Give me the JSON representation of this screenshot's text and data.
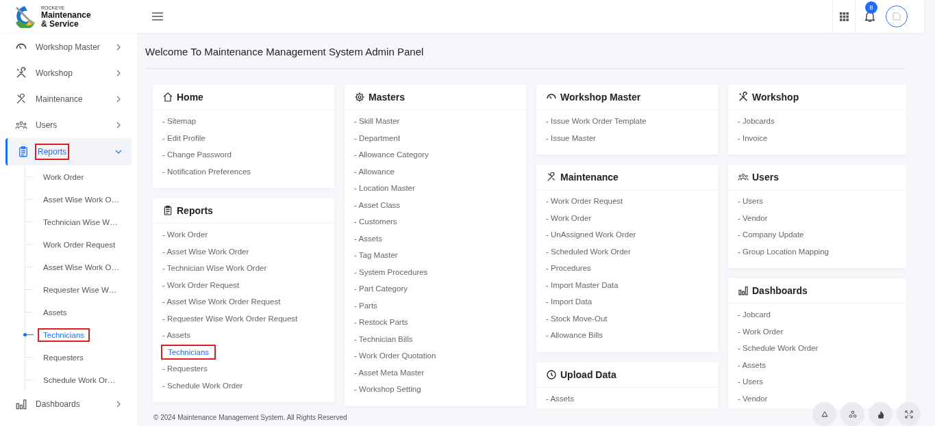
{
  "brand": {
    "small": "ROCKEYE",
    "name": "Maintenance",
    "name_2": "& Service"
  },
  "header": {
    "notification_count": "8"
  },
  "sidebar": {
    "items": [
      {
        "label": "Workshop Master",
        "kind": "gauge",
        "expanded": false,
        "selected": false,
        "highlighted": false
      },
      {
        "label": "Workshop",
        "kind": "tools",
        "expanded": false,
        "selected": false,
        "highlighted": false
      },
      {
        "label": "Maintenance",
        "kind": "wrench",
        "expanded": false,
        "selected": false,
        "highlighted": false
      },
      {
        "label": "Users",
        "kind": "users",
        "expanded": false,
        "selected": false,
        "highlighted": false
      },
      {
        "label": "Reports",
        "kind": "clipboard",
        "expanded": true,
        "selected": true,
        "highlighted": true,
        "children": [
          {
            "label": "Work Order",
            "selected": false,
            "highlighted": false
          },
          {
            "label": "Asset Wise Work O…",
            "selected": false,
            "highlighted": false
          },
          {
            "label": "Technician Wise W…",
            "selected": false,
            "highlighted": false
          },
          {
            "label": "Work Order Request",
            "selected": false,
            "highlighted": false
          },
          {
            "label": "Asset Wise Work O…",
            "selected": false,
            "highlighted": false
          },
          {
            "label": "Requester Wise W…",
            "selected": false,
            "highlighted": false
          },
          {
            "label": "Assets",
            "selected": false,
            "highlighted": false
          },
          {
            "label": "Technicians",
            "selected": true,
            "highlighted": true
          },
          {
            "label": "Requesters",
            "selected": false,
            "highlighted": false
          },
          {
            "label": "Schedule Work Or…",
            "selected": false,
            "highlighted": false
          }
        ]
      },
      {
        "label": "Dashboards",
        "kind": "chart",
        "expanded": false,
        "selected": false,
        "highlighted": false
      }
    ]
  },
  "page_title": "Welcome To Maintenance Management System Admin Panel",
  "columns": [
    [
      {
        "title": "Home",
        "kind": "home",
        "links": [
          {
            "label": "- Sitemap",
            "highlighted": false
          },
          {
            "label": "- Edit Profile",
            "highlighted": false
          },
          {
            "label": "- Change Password",
            "highlighted": false
          },
          {
            "label": "- Notification Preferences",
            "highlighted": false
          }
        ]
      },
      {
        "title": "Reports",
        "kind": "clipboard",
        "links": [
          {
            "label": "- Work Order",
            "highlighted": false
          },
          {
            "label": "- Asset Wise Work Order",
            "highlighted": false
          },
          {
            "label": "- Technician Wise Work Order",
            "highlighted": false
          },
          {
            "label": "- Work Order Request",
            "highlighted": false
          },
          {
            "label": "- Asset Wise Work Order Request",
            "highlighted": false
          },
          {
            "label": "- Requester Wise Work Order Request",
            "highlighted": false
          },
          {
            "label": "- Assets",
            "highlighted": false
          },
          {
            "label": "Technicians",
            "highlighted": true
          },
          {
            "label": "- Requesters",
            "highlighted": false
          },
          {
            "label": "- Schedule Work Order",
            "highlighted": false
          }
        ]
      }
    ],
    [
      {
        "title": "Masters",
        "kind": "gear",
        "links": [
          {
            "label": "- Skill Master",
            "highlighted": false
          },
          {
            "label": "- Department",
            "highlighted": false
          },
          {
            "label": "- Allowance Category",
            "highlighted": false
          },
          {
            "label": "- Allowance",
            "highlighted": false
          },
          {
            "label": "- Location Master",
            "highlighted": false
          },
          {
            "label": "- Asset Class",
            "highlighted": false
          },
          {
            "label": "- Customers",
            "highlighted": false
          },
          {
            "label": "- Assets",
            "highlighted": false
          },
          {
            "label": "- Tag Master",
            "highlighted": false
          },
          {
            "label": "- System Procedures",
            "highlighted": false
          },
          {
            "label": "- Part Category",
            "highlighted": false
          },
          {
            "label": "- Parts",
            "highlighted": false
          },
          {
            "label": "- Restock Parts",
            "highlighted": false
          },
          {
            "label": "- Technician Bills",
            "highlighted": false
          },
          {
            "label": "- Work Order Quotation",
            "highlighted": false
          },
          {
            "label": "- Asset Meta Master",
            "highlighted": false
          },
          {
            "label": "- Workshop Setting",
            "highlighted": false
          }
        ]
      }
    ],
    [
      {
        "title": "Workshop Master",
        "kind": "gauge",
        "links": [
          {
            "label": "- Issue Work Order Template",
            "highlighted": false
          },
          {
            "label": "- Issue Master",
            "highlighted": false
          }
        ]
      },
      {
        "title": "Maintenance",
        "kind": "wrench",
        "links": [
          {
            "label": "- Work Order Request",
            "highlighted": false
          },
          {
            "label": "- Work Order",
            "highlighted": false
          },
          {
            "label": "- UnAssigned Work Order",
            "highlighted": false
          },
          {
            "label": "- Scheduled Work Order",
            "highlighted": false
          },
          {
            "label": "- Procedures",
            "highlighted": false
          },
          {
            "label": "- Import Master Data",
            "highlighted": false
          },
          {
            "label": "- Import Data",
            "highlighted": false
          },
          {
            "label": "- Stock Move-Out",
            "highlighted": false
          },
          {
            "label": "- Allowance Bills",
            "highlighted": false
          }
        ]
      },
      {
        "title": "Upload Data",
        "kind": "clock",
        "links": [
          {
            "label": "- Assets",
            "highlighted": false
          }
        ]
      }
    ],
    [
      {
        "title": "Workshop",
        "kind": "tools",
        "links": [
          {
            "label": "- Jobcards",
            "highlighted": false
          },
          {
            "label": "- Invoice",
            "highlighted": false
          }
        ]
      },
      {
        "title": "Users",
        "kind": "users",
        "links": [
          {
            "label": "- Users",
            "highlighted": false
          },
          {
            "label": "- Vendor",
            "highlighted": false
          },
          {
            "label": "- Company Update",
            "highlighted": false
          },
          {
            "label": "- Group Location Mapping",
            "highlighted": false
          }
        ]
      },
      {
        "title": "Dashboards",
        "kind": "chart",
        "links": [
          {
            "label": "- Jobcard",
            "highlighted": false
          },
          {
            "label": "- Work Order",
            "highlighted": false
          },
          {
            "label": "- Schedule Work Order",
            "highlighted": false
          },
          {
            "label": "- Assets",
            "highlighted": false
          },
          {
            "label": "- Users",
            "highlighted": false
          },
          {
            "label": "- Vendor",
            "highlighted": false
          }
        ]
      }
    ]
  ],
  "footer": "© 2024 Maintenance Management System. All Rights Reserved"
}
